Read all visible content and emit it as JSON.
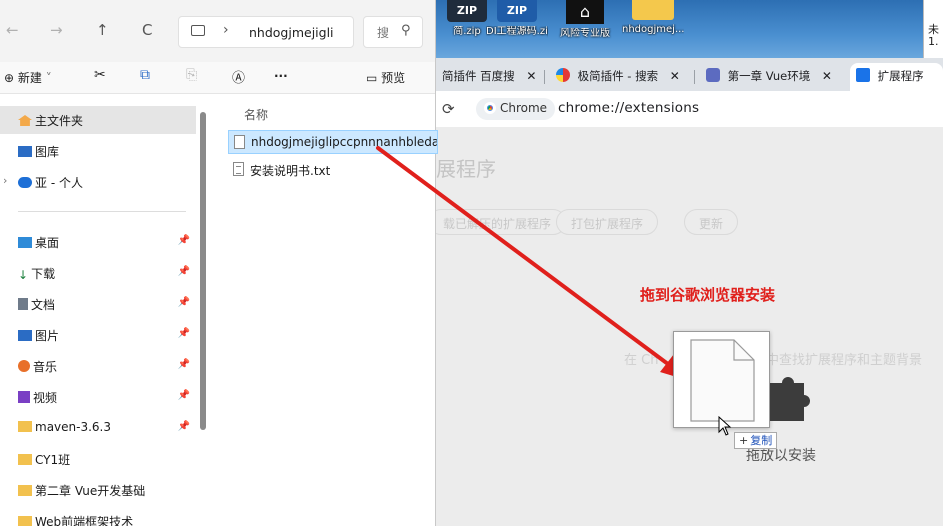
{
  "desktop": {
    "icons": [
      {
        "badge": "ZIP",
        "label": "简.zip"
      },
      {
        "badge": "ZIP",
        "label": "DI工程源码.zip"
      },
      {
        "badge": "",
        "label": "风险专业版"
      },
      {
        "badge": "",
        "label": "nhdogjmej..."
      }
    ],
    "edge_text": "未 1."
  },
  "chrome": {
    "tabs": [
      {
        "label": "简插件 百度搜",
        "close": "✕"
      },
      {
        "label": "极简插件 - 搜索",
        "close": "✕"
      },
      {
        "label": "第一章 Vue环境",
        "close": "✕"
      },
      {
        "label": "扩展程序",
        "close": ""
      }
    ],
    "reload_icon": "⟳",
    "chip_label": "Chrome",
    "url": "chrome://extensions",
    "page_title": "展程序",
    "buttons": [
      "载已解压的扩展程序",
      "打包扩展程序",
      "更新"
    ],
    "faint_left": "在 Ch",
    "faint_right": "中查找扩展程序和主题背景",
    "drop_label": "拖放以安装",
    "annotation": "拖到谷歌浏览器安装",
    "copy_badge": {
      "plus": "+",
      "label": "复制"
    },
    "colors": {
      "annotation": "#e0201c",
      "arrow": "#e0201c"
    }
  },
  "explorer": {
    "nav": {
      "back": "←",
      "forward": "→",
      "up": "↑",
      "refresh": "C"
    },
    "address": {
      "sep": "›",
      "path": "nhdogjmejigli"
    },
    "search": {
      "placeholder": "搜",
      "icon": "⚲"
    },
    "commands": {
      "new_label": "新建",
      "new_chevron": "˅",
      "cut": "✂",
      "copy": "⧉",
      "paste": "⎘",
      "rename": "Ⓐ",
      "more": "···",
      "preview": "预览"
    },
    "sidebar": [
      {
        "label": "主文件夹",
        "pin": ""
      },
      {
        "label": "图库",
        "pin": ""
      },
      {
        "label": "亚 - 个人",
        "pin": ""
      },
      {
        "label": "桌面",
        "pin": "📌"
      },
      {
        "label": "下载",
        "pin": "📌"
      },
      {
        "label": "文档",
        "pin": "📌"
      },
      {
        "label": "图片",
        "pin": "📌"
      },
      {
        "label": "音乐",
        "pin": "📌"
      },
      {
        "label": "视频",
        "pin": "📌"
      },
      {
        "label": "maven-3.6.3",
        "pin": "📌"
      },
      {
        "label": "CY1班",
        "pin": ""
      },
      {
        "label": "第二章 Vue开发基础",
        "pin": ""
      },
      {
        "label": "Web前端框架技术",
        "pin": ""
      }
    ],
    "column_name": "名称",
    "files": [
      {
        "name": "nhdogjmejiglipccpnnnanhbledajbpd"
      },
      {
        "name": "安装说明书.txt"
      }
    ]
  }
}
